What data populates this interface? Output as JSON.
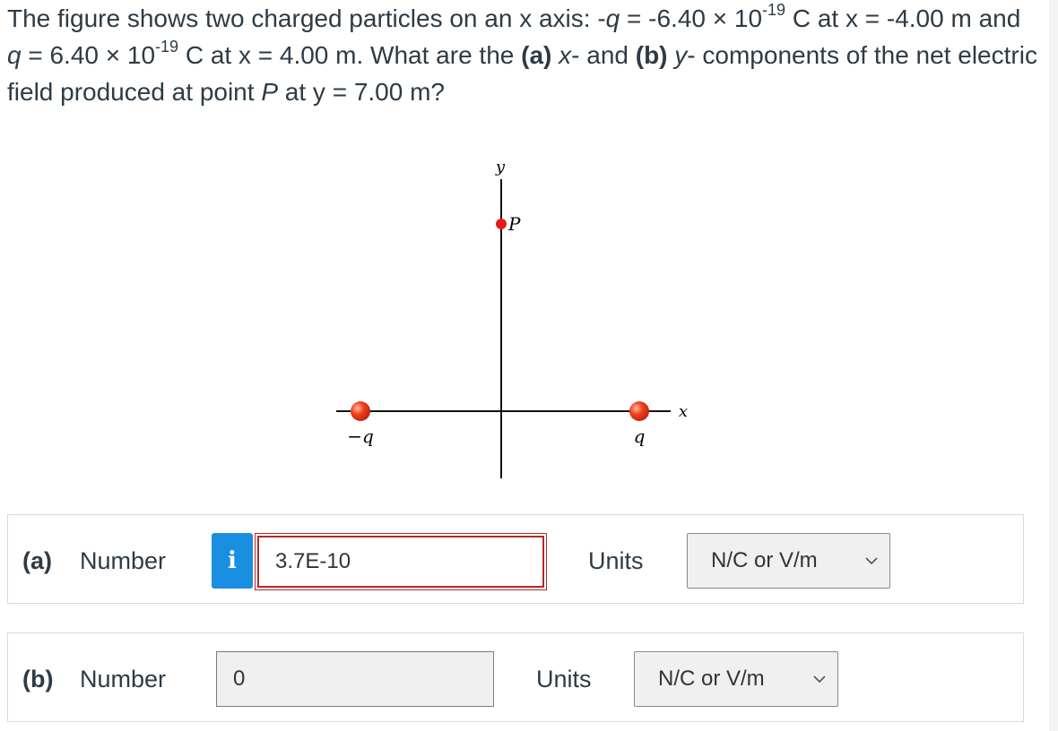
{
  "question": {
    "s1": "The figure shows two charged particles on an x axis: -",
    "q1": "q",
    "s2": " = -6.40 × 10",
    "e1": "-19",
    "s3": " C at x = -4.00 m and ",
    "q2": "q",
    "s4": " = 6.40 × 10",
    "e2": "-19",
    "s5": " C at x = 4.00 m. What are the ",
    "a_tag": "(a)",
    "s6": " ",
    "x_it": "x",
    "s7": "- and ",
    "b_tag": "(b)",
    "s8": " ",
    "y_it": "y",
    "s9": "- components of the net electric field produced at point ",
    "p_it": "P",
    "s10": " at y = 7.00 m?"
  },
  "figure": {
    "y_axis_label": "y",
    "x_axis_label": "x",
    "point_label": "P",
    "neg_charge_label": "−q",
    "pos_charge_label": "q",
    "charge_color": "#e8391e",
    "point_color": "#e8191e"
  },
  "part_a": {
    "part": "(a)",
    "number_label": "Number",
    "info_icon": "i",
    "value": "3.7E-10",
    "units_label": "Units",
    "units_value": "N/C or V/m"
  },
  "part_b": {
    "part": "(b)",
    "number_label": "Number",
    "value": "0",
    "units_label": "Units",
    "units_value": "N/C or V/m"
  }
}
